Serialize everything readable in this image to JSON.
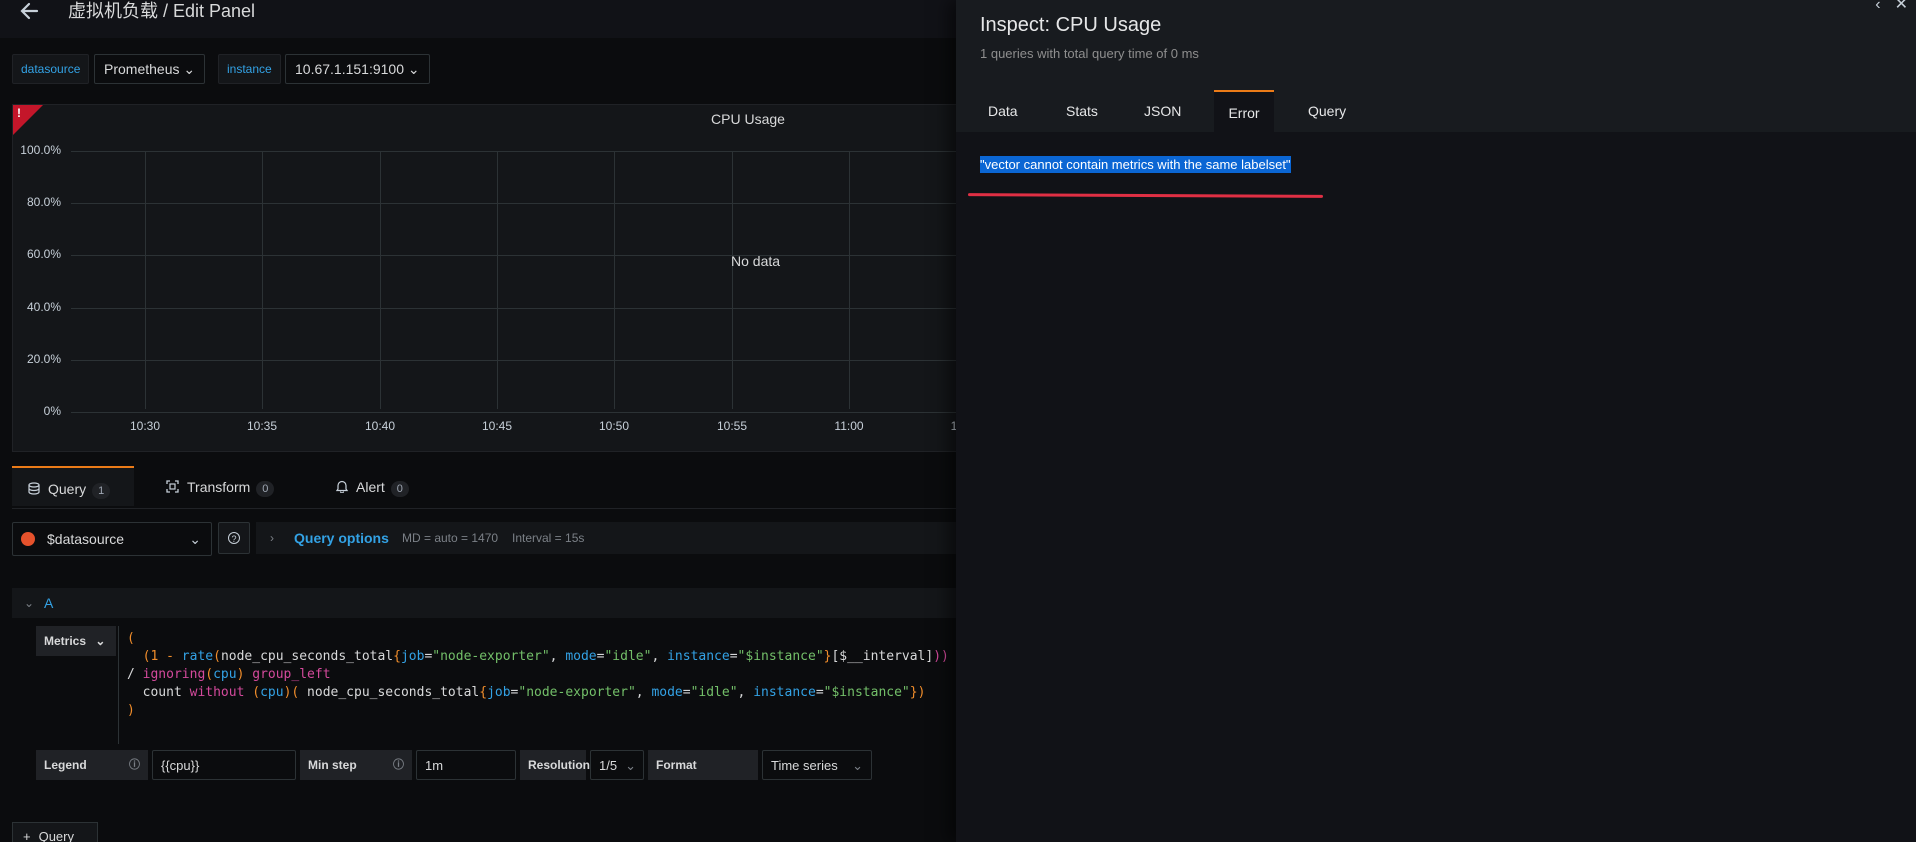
{
  "header": {
    "title": "虚拟机负载 / Edit Panel"
  },
  "variables": [
    {
      "label": "datasource",
      "value": "Prometheus ⌄"
    },
    {
      "label": "instance",
      "value": "10.67.1.151:9100 ⌄"
    }
  ],
  "panel": {
    "title": "CPU Usage",
    "alert_glyph": "!",
    "no_data": "No data",
    "y_ticks": [
      "100.0%",
      "80.0%",
      "60.0%",
      "40.0%",
      "20.0%",
      "0%"
    ],
    "x_ticks": [
      "10:30",
      "10:35",
      "10:40",
      "10:45",
      "10:50",
      "10:55",
      "11:00",
      "1"
    ]
  },
  "editor_tabs": {
    "query": {
      "label": "Query",
      "count": "1"
    },
    "transform": {
      "label": "Transform",
      "count": "0"
    },
    "alert": {
      "label": "Alert",
      "count": "0"
    }
  },
  "datasource_picker": {
    "value": "$datasource"
  },
  "query_options": {
    "label": "Query options",
    "md": "MD = auto = 1470",
    "interval": "Interval = 15s"
  },
  "query_row": {
    "ref": "A"
  },
  "metrics": {
    "label": "Metrics",
    "lines": [
      "(",
      "  (1 - rate(node_cpu_seconds_total{job=\"node-exporter\", mode=\"idle\", instance=\"$instance\"}[$__interval]))",
      "/ ignoring(cpu) group_left",
      "  count without (cpu)( node_cpu_seconds_total{job=\"node-exporter\", mode=\"idle\", instance=\"$instance\"})",
      ")"
    ]
  },
  "options": {
    "legend_label": "Legend",
    "legend_value": "{{cpu}}",
    "minstep_label": "Min step",
    "minstep_value": "1m",
    "resolution_label": "Resolution",
    "resolution_value": "1/5",
    "format_label": "Format",
    "format_value": "Time series"
  },
  "add_query": {
    "label": "Query"
  },
  "inspect": {
    "title": "Inspect: CPU Usage",
    "subtitle": "1 queries with total query time of 0 ms",
    "tabs": [
      "Data",
      "Stats",
      "JSON",
      "Error",
      "Query"
    ],
    "active_tab": "Error",
    "error_message": "\"vector cannot contain metrics with the same labelset\""
  },
  "colors": {
    "accent_orange": "#eb7b18",
    "link_blue": "#33a2e5",
    "alert_red": "#c4162a",
    "selection_blue": "#0b66d4",
    "underline_red": "#e02f44"
  }
}
